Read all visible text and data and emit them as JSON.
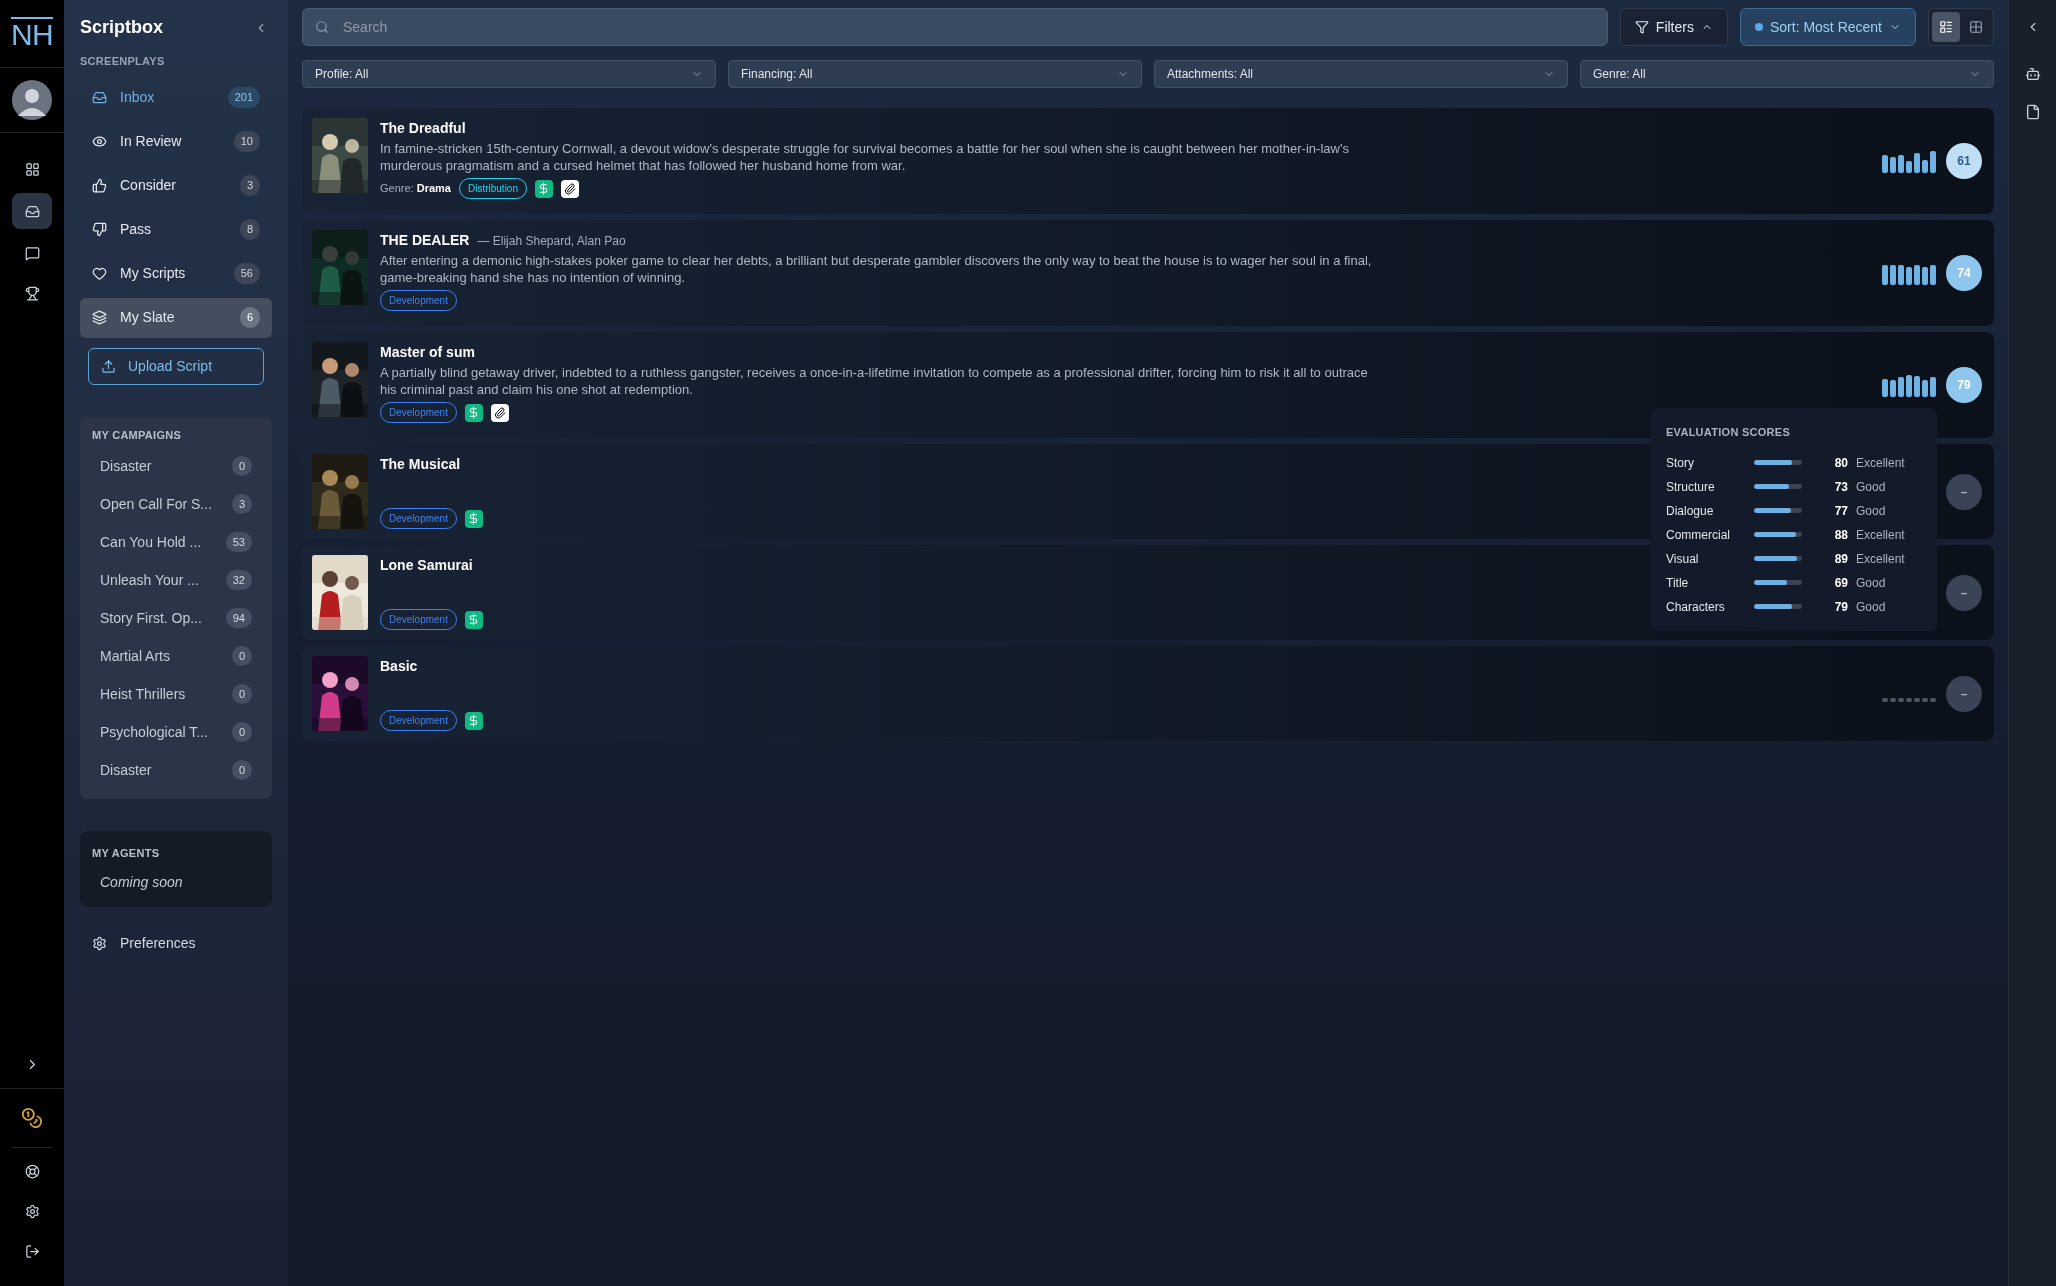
{
  "rail": {
    "logo": "NH",
    "top_icons": [
      {
        "kind": "grid",
        "selected": false
      },
      {
        "kind": "inbox",
        "selected": true
      },
      {
        "kind": "message",
        "selected": false
      },
      {
        "kind": "trophy",
        "selected": false
      }
    ]
  },
  "sidebar": {
    "title": "Scriptbox",
    "section": "SCREENPLAYS",
    "items": [
      {
        "kind": "inbox",
        "label": "Inbox",
        "count": "201",
        "active": true,
        "selected": false
      },
      {
        "kind": "eye",
        "label": "In Review",
        "count": "10",
        "active": false,
        "selected": false
      },
      {
        "kind": "thumbs-up",
        "label": "Consider",
        "count": "3",
        "active": false,
        "selected": false
      },
      {
        "kind": "thumbs-down",
        "label": "Pass",
        "count": "8",
        "active": false,
        "selected": false
      },
      {
        "kind": "heart",
        "label": "My Scripts",
        "count": "56",
        "active": false,
        "selected": false
      },
      {
        "kind": "layers",
        "label": "My Slate",
        "count": "6",
        "active": false,
        "selected": true
      }
    ],
    "upload_button": "Upload Script",
    "campaigns": {
      "title": "MY CAMPAIGNS",
      "items": [
        {
          "name": "Disaster",
          "count": "0"
        },
        {
          "name": "Open Call For S...",
          "count": "3"
        },
        {
          "name": "Can You Hold ...",
          "count": "53"
        },
        {
          "name": "Unleash Your ...",
          "count": "32"
        },
        {
          "name": "Story First. Op...",
          "count": "94"
        },
        {
          "name": "Martial Arts",
          "count": "0"
        },
        {
          "name": "Heist Thrillers",
          "count": "0"
        },
        {
          "name": "Psychological T...",
          "count": "0"
        },
        {
          "name": "Disaster",
          "count": "0"
        }
      ]
    },
    "agents": {
      "title": "MY AGENTS",
      "note": "Coming soon"
    },
    "preferences": "Preferences"
  },
  "toolbar": {
    "search": {
      "placeholder": "Search"
    },
    "filters_button": "Filters",
    "sort_button": "Sort: Most Recent",
    "views": [
      {
        "kind": "list",
        "selected": true
      },
      {
        "kind": "grid",
        "selected": false
      }
    ]
  },
  "filters": [
    "Profile: All",
    "Financing: All",
    "Attachments: All",
    "Genre: All"
  ],
  "scripts": [
    {
      "title": "The Dreadful",
      "description": "In famine-stricken 15th-century Cornwall, a devout widow's desperate struggle for survival becomes a battle for her soul when she is caught between her mother-in-law's murderous pragmatism and a cursed helmet that has followed her husband home from war.",
      "genre_label": "Genre:",
      "genre": "Drama",
      "stage": {
        "label": "Distribution",
        "color": "#22d3ee"
      },
      "financing": true,
      "attachment": true,
      "evaluated": true,
      "score": {
        "value": "61",
        "color": "#bfdff5"
      }
    },
    {
      "title": "THE DEALER",
      "authors": "— Elijah Shepard, Alan Pao",
      "description": "After entering a demonic high-stakes poker game to clear her debts, a brilliant but desperate gambler discovers the only way to beat the house is to wager her soul in a final, game-breaking hand she has no intention of winning.",
      "stage": {
        "label": "Development",
        "color": "#3b82f6"
      },
      "financing": false,
      "attachment": false,
      "evaluated": true,
      "score": {
        "value": "74",
        "color": "#8fc6ee"
      }
    },
    {
      "title": "Master of sum",
      "description": "A partially blind getaway driver, indebted to a ruthless gangster, receives a once-in-a-lifetime invitation to compete as a professional drifter, forcing him to risk it all to outrace his criminal past and claim his one shot at redemption.",
      "stage": {
        "label": "Development",
        "color": "#3b82f6"
      },
      "financing": true,
      "attachment": true,
      "evaluated": true,
      "score": {
        "value": "79",
        "color": "#8fc6ee"
      }
    },
    {
      "title": "The Musical",
      "stage": {
        "label": "Development",
        "color": "#3b82f6"
      },
      "financing": true,
      "attachment": false,
      "evaluated": false,
      "score": {
        "value": "–",
        "color": "#3a4456"
      }
    },
    {
      "title": "Lone Samurai",
      "stage": {
        "label": "Development",
        "color": "#3b82f6"
      },
      "financing": true,
      "attachment": false,
      "evaluated": false,
      "score": {
        "value": "–",
        "color": "#3a4456"
      }
    },
    {
      "title": "Basic",
      "stage": {
        "label": "Development",
        "color": "#3b82f6"
      },
      "financing": true,
      "attachment": false,
      "evaluated": false,
      "score": {
        "value": "–",
        "color": "#3a4456"
      }
    }
  ],
  "evaluation": {
    "title": "EVALUATION SCORES",
    "items": [
      {
        "name": "Story",
        "level": 0.8,
        "value": "80",
        "rating": "Excellent"
      },
      {
        "name": "Structure",
        "level": 0.73,
        "value": "73",
        "rating": "Good"
      },
      {
        "name": "Dialogue",
        "level": 0.77,
        "value": "77",
        "rating": "Good"
      },
      {
        "name": "Commercial",
        "level": 0.88,
        "value": "88",
        "rating": "Excellent"
      },
      {
        "name": "Visual",
        "level": 0.89,
        "value": "89",
        "rating": "Excellent"
      },
      {
        "name": "Title",
        "level": 0.69,
        "value": "69",
        "rating": "Good"
      },
      {
        "name": "Characters",
        "level": 0.79,
        "value": "79",
        "rating": "Good"
      }
    ]
  }
}
